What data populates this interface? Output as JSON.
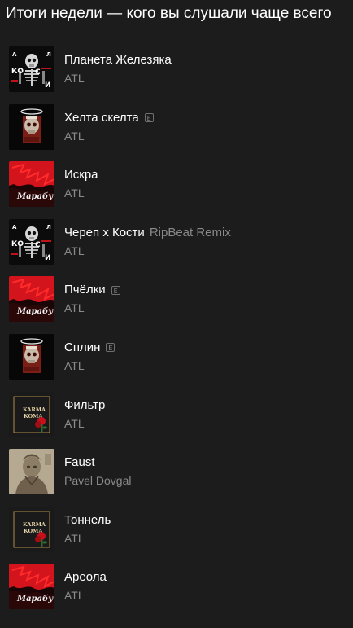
{
  "title": "Итоги недели — кого вы слушали чаще всего",
  "tracks": [
    {
      "name": "Планета Железяка",
      "version": "",
      "explicit": false,
      "artist": "ATL",
      "cover": "kosti-skeleton-cover"
    },
    {
      "name": "Хелта скелта",
      "version": "",
      "explicit": true,
      "explicit_mark": "E",
      "artist": "ATL",
      "cover": "skull-halo-cover"
    },
    {
      "name": "Искра",
      "version": "",
      "explicit": false,
      "artist": "ATL",
      "cover": "red-marabu-cover"
    },
    {
      "name": "Череп х Кости",
      "version": "RipBeat Remix",
      "explicit": false,
      "artist": "ATL",
      "cover": "kosti-skeleton-cover"
    },
    {
      "name": "Пчёлки",
      "version": "",
      "explicit": true,
      "explicit_mark": "E",
      "artist": "ATL",
      "cover": "red-marabu-cover"
    },
    {
      "name": "Сплин",
      "version": "",
      "explicit": true,
      "explicit_mark": "E",
      "artist": "ATL",
      "cover": "skull-halo-cover"
    },
    {
      "name": "Фильтр",
      "version": "",
      "explicit": false,
      "artist": "ATL",
      "cover": "karma-koma-cover"
    },
    {
      "name": "Faust",
      "version": "",
      "explicit": false,
      "artist": "Pavel Dovgal",
      "cover": "faust-portrait-cover"
    },
    {
      "name": "Тоннель",
      "version": "",
      "explicit": false,
      "artist": "ATL",
      "cover": "karma-koma-cover"
    },
    {
      "name": "Ареола",
      "version": "",
      "explicit": false,
      "artist": "ATL",
      "cover": "red-marabu-cover"
    }
  ],
  "colors": {
    "background": "#1c1c1c",
    "primary_text": "#ffffff",
    "secondary_text": "#8a8a8a",
    "accent_red": "#d4141c"
  }
}
